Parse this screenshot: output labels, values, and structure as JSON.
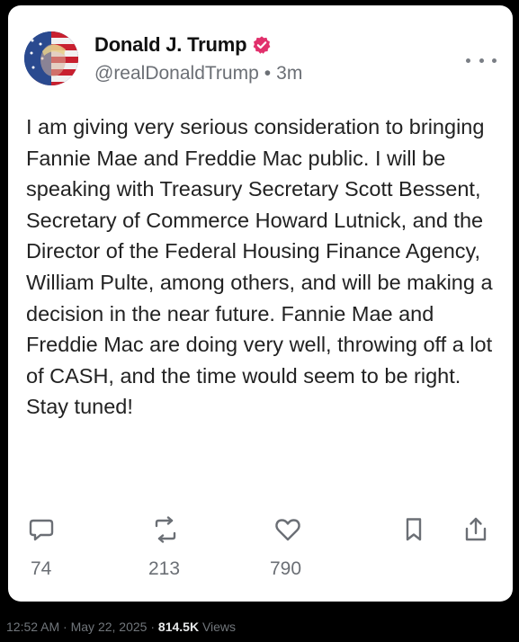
{
  "post": {
    "author_name": "Donald J. Trump",
    "handle": "@realDonaldTrump",
    "separator": "•",
    "time_ago": "3m",
    "text": "I am giving very serious consideration to bringing Fannie Mae and Freddie Mac public. I will be speaking with Treasury Secretary Scott Bessent, Secretary of Commerce Howard Lutnick, and the Director of the Federal Housing Finance Agency, William Pulte, among others, and will be making a decision in the near future. Fannie Mae and Freddie Mac are doing very well, throwing off a lot of CASH, and the time would seem to be right. Stay tuned!",
    "verified_icon": "verified-badge-icon",
    "more_icon": "more-options-icon"
  },
  "actions": {
    "replies": {
      "icon": "reply-icon",
      "count": "74"
    },
    "reposts": {
      "icon": "repost-icon",
      "count": "213"
    },
    "likes": {
      "icon": "heart-icon",
      "count": "790"
    },
    "bookmark": {
      "icon": "bookmark-icon"
    },
    "share": {
      "icon": "share-icon"
    }
  },
  "footer": {
    "time": "12:52 AM",
    "dot1": "·",
    "date": "May 22, 2025",
    "dot2": "·",
    "views_count": "814.5K",
    "views_label": "Views"
  },
  "colors": {
    "background": "#000000",
    "card": "#ffffff",
    "text": "#222222",
    "muted": "#6b6f75",
    "verified_badge": "#e1306c"
  }
}
